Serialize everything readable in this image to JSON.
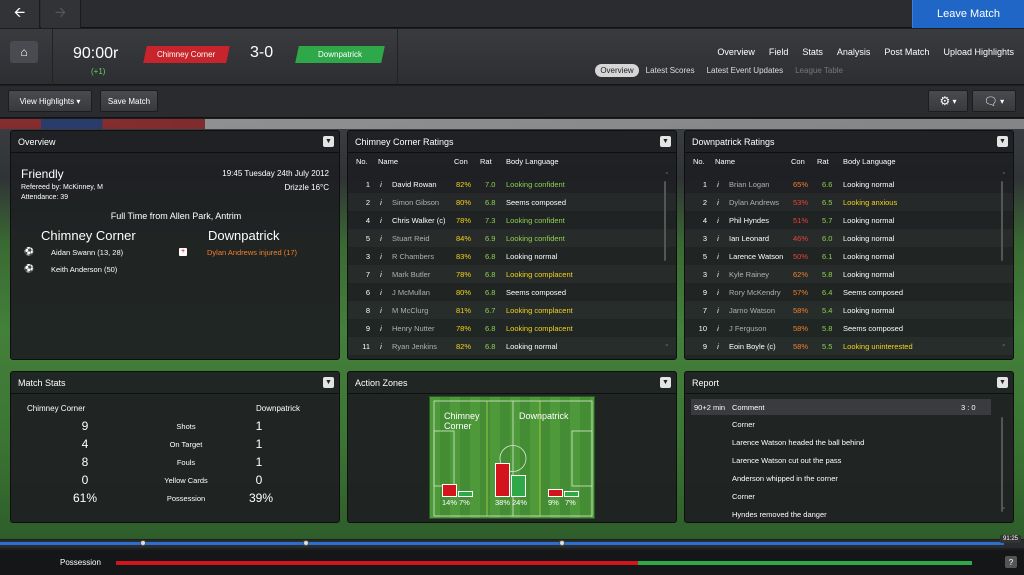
{
  "nav": {
    "back_icon": "arrow-left-icon",
    "forward_icon": "arrow-right-icon",
    "leave_label": "Leave Match"
  },
  "header": {
    "clock": "90:00r",
    "added_time": "(+1)",
    "home_team": "Chimney Corner",
    "away_team": "Downpatrick",
    "score": "3-0",
    "home_color": "#c8242b",
    "away_color": "#2fa84a",
    "main_nav": [
      "Overview",
      "Field",
      "Stats",
      "Analysis",
      "Post Match",
      "Upload Highlights"
    ],
    "sub_nav": [
      "Overview",
      "Latest Scores",
      "Latest Event Updates",
      "League Table"
    ]
  },
  "toolbar": {
    "view_highlights": "View Highlights",
    "save_match": "Save Match"
  },
  "overview": {
    "title": "Overview",
    "match_type": "Friendly",
    "datetime": "19:45 Tuesday 24th July 2012",
    "referee": "Refereed by: McKinney, M",
    "weather": "Drizzle 16°C",
    "attendance": "Attendance: 39",
    "full_time": "Full Time from Allen Park, Antrim",
    "home_team": "Chimney Corner",
    "away_team": "Downpatrick",
    "home_events": [
      "Aidan Swann (13, 28)",
      "Keith Anderson (50)"
    ],
    "away_events": [
      "Dylan Andrews injured (17)"
    ]
  },
  "home_ratings": {
    "title": "Chimney Corner Ratings",
    "cols": [
      "No.",
      "Name",
      "Con",
      "Rat",
      "Body Language"
    ],
    "rows": [
      {
        "no": "1",
        "name": "David Rowan",
        "con": "82%",
        "rat": "7.0",
        "body": "Looking confident",
        "nc": "white",
        "cc": "yellow",
        "bc": "green"
      },
      {
        "no": "2",
        "name": "Simon Gibson",
        "con": "80%",
        "rat": "6.8",
        "body": "Seems composed",
        "nc": "grey",
        "cc": "yellow",
        "bc": "white"
      },
      {
        "no": "4",
        "name": "Chris Walker (c)",
        "con": "78%",
        "rat": "7.3",
        "body": "Looking confident",
        "nc": "white",
        "cc": "yellow",
        "bc": "green"
      },
      {
        "no": "5",
        "name": "Stuart Reid",
        "con": "84%",
        "rat": "6.9",
        "body": "Looking confident",
        "nc": "grey",
        "cc": "yellow",
        "bc": "green"
      },
      {
        "no": "3",
        "name": "R Chambers",
        "con": "83%",
        "rat": "6.8",
        "body": "Looking normal",
        "nc": "grey",
        "cc": "yellow",
        "bc": "white"
      },
      {
        "no": "7",
        "name": "Mark Butler",
        "con": "78%",
        "rat": "6.8",
        "body": "Looking complacent",
        "nc": "grey",
        "cc": "yellow",
        "bc": "yellow"
      },
      {
        "no": "6",
        "name": "J McMullan",
        "con": "80%",
        "rat": "6.8",
        "body": "Seems composed",
        "nc": "grey",
        "cc": "yellow",
        "bc": "white"
      },
      {
        "no": "8",
        "name": "M McClurg",
        "con": "81%",
        "rat": "6.7",
        "body": "Looking complacent",
        "nc": "grey",
        "cc": "yellow",
        "bc": "yellow"
      },
      {
        "no": "9",
        "name": "Henry Nutter",
        "con": "78%",
        "rat": "6.8",
        "body": "Looking complacent",
        "nc": "grey",
        "cc": "yellow",
        "bc": "yellow"
      },
      {
        "no": "11",
        "name": "Ryan Jenkins",
        "con": "82%",
        "rat": "6.8",
        "body": "Looking normal",
        "nc": "grey",
        "cc": "yellow",
        "bc": "white"
      }
    ]
  },
  "away_ratings": {
    "title": "Downpatrick Ratings",
    "cols": [
      "No.",
      "Name",
      "Con",
      "Rat",
      "Body Language"
    ],
    "rows": [
      {
        "no": "1",
        "name": "Brian Logan",
        "con": "65%",
        "rat": "6.6",
        "body": "Looking normal",
        "nc": "grey",
        "cc": "orange",
        "bc": "white"
      },
      {
        "no": "2",
        "name": "Dylan Andrews",
        "con": "53%",
        "rat": "6.5",
        "body": "Looking anxious",
        "nc": "grey",
        "cc": "red",
        "bc": "yellow"
      },
      {
        "no": "4",
        "name": "Phil Hyndes",
        "con": "51%",
        "rat": "5.7",
        "body": "Looking normal",
        "nc": "white",
        "cc": "red",
        "bc": "white"
      },
      {
        "no": "3",
        "name": "Ian Leonard",
        "con": "46%",
        "rat": "6.0",
        "body": "Looking normal",
        "nc": "white",
        "cc": "red",
        "bc": "white"
      },
      {
        "no": "5",
        "name": "Larence Watson",
        "con": "50%",
        "rat": "6.1",
        "body": "Looking normal",
        "nc": "white",
        "cc": "red",
        "bc": "white"
      },
      {
        "no": "3",
        "name": "Kyle Rainey",
        "con": "62%",
        "rat": "5.8",
        "body": "Looking normal",
        "nc": "grey",
        "cc": "orange",
        "bc": "white"
      },
      {
        "no": "9",
        "name": "Rory McKendry",
        "con": "57%",
        "rat": "6.4",
        "body": "Seems composed",
        "nc": "grey",
        "cc": "orange",
        "bc": "white"
      },
      {
        "no": "7",
        "name": "Jarno Watson",
        "con": "58%",
        "rat": "5.4",
        "body": "Looking normal",
        "nc": "grey",
        "cc": "orange",
        "bc": "white"
      },
      {
        "no": "10",
        "name": "J Ferguson",
        "con": "58%",
        "rat": "5.8",
        "body": "Seems composed",
        "nc": "grey",
        "cc": "orange",
        "bc": "white"
      },
      {
        "no": "9",
        "name": "Eoin Boyle (c)",
        "con": "58%",
        "rat": "5.5",
        "body": "Looking uninterested",
        "nc": "white",
        "cc": "orange",
        "bc": "yellow"
      }
    ]
  },
  "match_stats": {
    "title": "Match Stats",
    "home_team": "Chimney Corner",
    "away_team": "Downpatrick",
    "rows": [
      {
        "label": "Shots",
        "home": "9",
        "away": "1"
      },
      {
        "label": "On Target",
        "home": "4",
        "away": "1"
      },
      {
        "label": "Fouls",
        "home": "8",
        "away": "1"
      },
      {
        "label": "Yellow Cards",
        "home": "0",
        "away": "0"
      },
      {
        "label": "Possession",
        "home": "61%",
        "away": "39%"
      }
    ]
  },
  "action_zones": {
    "title": "Action Zones",
    "home_team": "Chimney Corner",
    "away_team": "Downpatrick",
    "zones": [
      {
        "home": "14%",
        "away": "7%",
        "home_val": 14,
        "away_val": 7
      },
      {
        "home": "38%",
        "away": "24%",
        "home_val": 38,
        "away_val": 24
      },
      {
        "home": "9%",
        "away": "7%",
        "home_val": 9,
        "away_val": 7
      }
    ]
  },
  "report": {
    "title": "Report",
    "time": "90+2 min",
    "type": "Comment",
    "score": "3 : 0",
    "lines": [
      "Corner",
      "Larence Watson headed the ball behind",
      "Larence Watson cut out the pass",
      "Anderson whipped in the corner",
      "Corner",
      "Hyndes removed the danger"
    ]
  },
  "timeline": {
    "time": "91:25",
    "progress": 0.98
  },
  "possession": {
    "label": "Possession",
    "home": 0.61
  }
}
